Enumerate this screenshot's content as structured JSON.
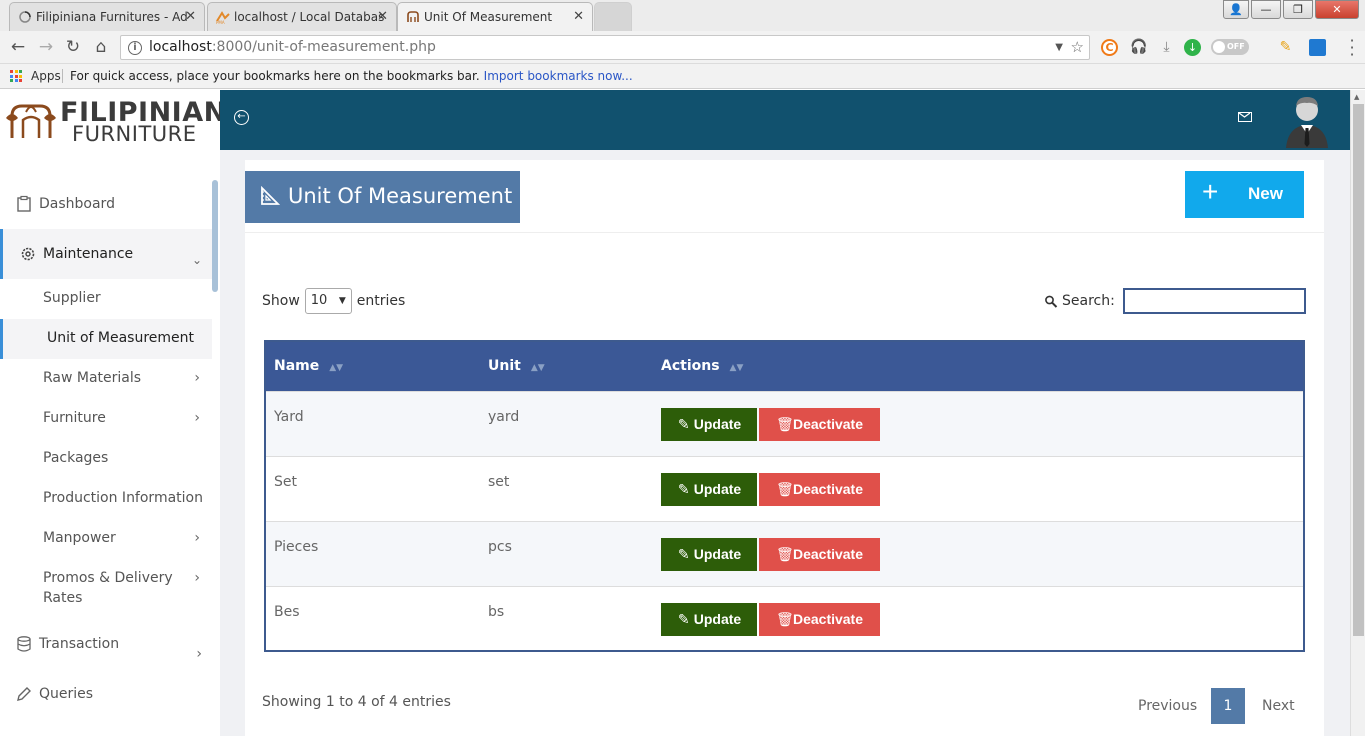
{
  "browser": {
    "tabs": [
      {
        "title": "Filipiniana Furnitures - Ad",
        "active": false
      },
      {
        "title": "localhost / Local Databas",
        "active": false
      },
      {
        "title": "Unit Of Measurement",
        "active": true
      }
    ],
    "url_host": "localhost",
    "url_rest": ":8000/unit-of-measurement.php",
    "toggle_label": "OFF",
    "bookmarks": {
      "apps_label": "Apps",
      "hint": "For quick access, place your bookmarks here on the bookmarks bar.",
      "import_link": "Import bookmarks now..."
    }
  },
  "logo": {
    "line1": "FILIPINIANA",
    "line2": "FURNITURE"
  },
  "sidebar": {
    "dashboard": "Dashboard",
    "maintenance": "Maintenance",
    "sub": {
      "supplier": "Supplier",
      "uom": "Unit of Measurement",
      "raw_materials": "Raw Materials",
      "furniture": "Furniture",
      "packages": "Packages",
      "production": "Production Information",
      "manpower": "Manpower",
      "promos_line1": "Promos & Delivery",
      "promos_line2": "Rates"
    },
    "transaction": "Transaction",
    "queries": "Queries"
  },
  "header": {
    "page_title": "Unit Of Measurement",
    "new_button": "New"
  },
  "table_controls": {
    "show_label": "Show",
    "length_value": "10",
    "entries_label": "entries",
    "search_label": "Search:"
  },
  "table": {
    "columns": [
      "Name",
      "Unit",
      "Actions"
    ],
    "rows": [
      {
        "name": "Yard",
        "unit": "yard"
      },
      {
        "name": "Set",
        "unit": "set"
      },
      {
        "name": "Pieces",
        "unit": "pcs"
      },
      {
        "name": "Bes",
        "unit": "bs"
      }
    ],
    "update_label": "Update",
    "deactivate_label": "Deactivate"
  },
  "footer": {
    "info": "Showing 1 to 4 of 4 entries",
    "previous": "Previous",
    "current_page": "1",
    "next": "Next"
  },
  "colors": {
    "topbar": "#11516e",
    "title_block": "#537aa7",
    "new_button": "#11a9ec",
    "table_header": "#3b5896",
    "update_button": "#2d5d09",
    "deactivate_button": "#e0504a",
    "active_accent": "#3a8fd8"
  }
}
